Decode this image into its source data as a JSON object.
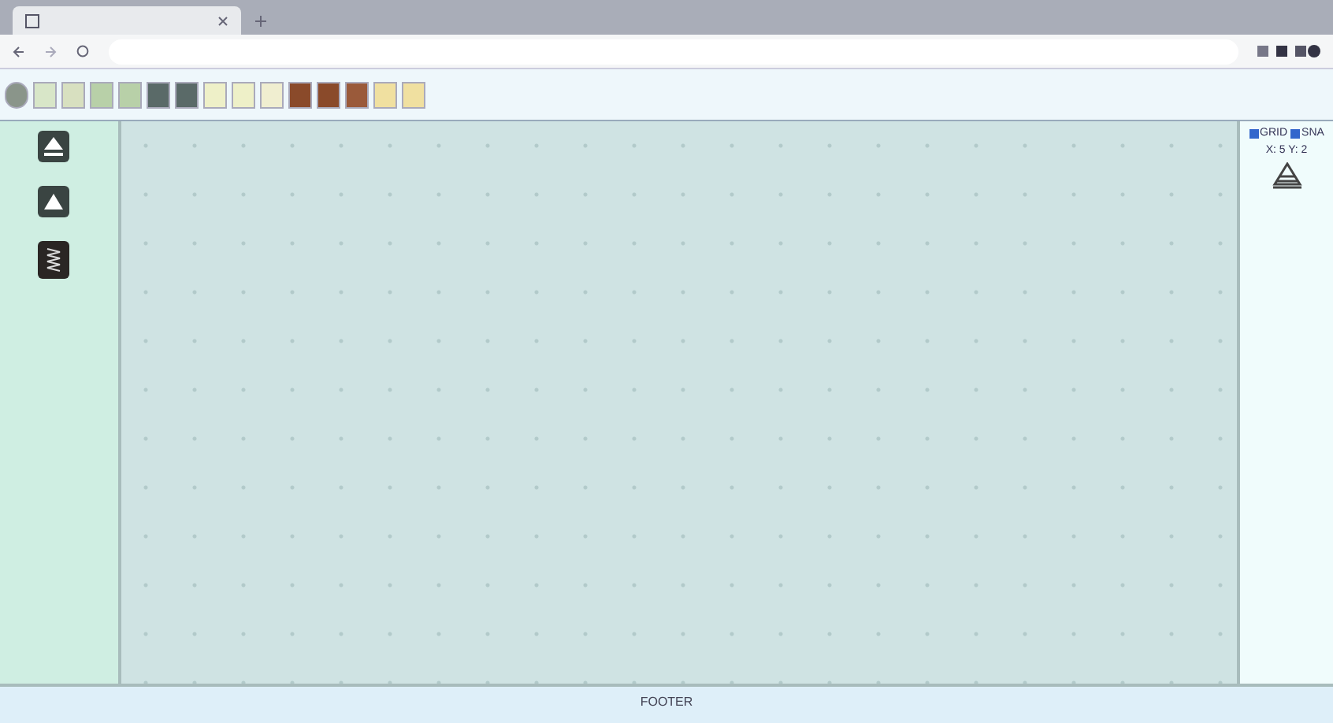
{
  "options": [
    {
      "label": "GRID",
      "checked": true
    },
    {
      "label": "SNA",
      "checked": true
    }
  ],
  "coordinates": "X: 5 Y: 2",
  "footer": "FOOTER"
}
